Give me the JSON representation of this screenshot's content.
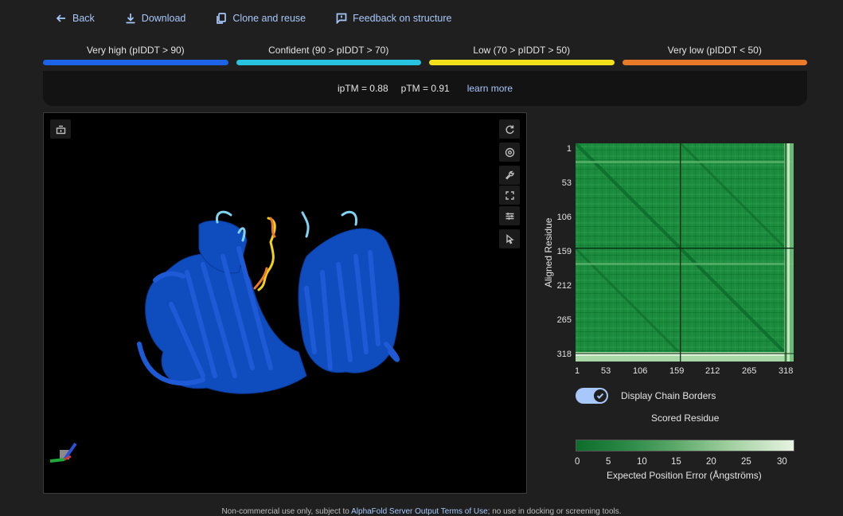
{
  "toolbar": {
    "back_label": "Back",
    "download_label": "Download",
    "clone_label": "Clone and reuse",
    "feedback_label": "Feedback on structure"
  },
  "plddt_legend": [
    {
      "label": "Very high (pIDDT > 90)",
      "color": "#1c63e8"
    },
    {
      "label": "Confident (90 > pIDDT > 70)",
      "color": "#27c3e0"
    },
    {
      "label": "Low (70 > pIDDT > 50)",
      "color": "#f2e01a"
    },
    {
      "label": "Very low (pIDDT < 50)",
      "color": "#ea7a2a"
    }
  ],
  "scores": {
    "iptm": "ipTM = 0.88",
    "ptm": "pTM = 0.91",
    "learn_more": "learn more"
  },
  "viewer": {
    "icons": [
      "expand-panel-icon",
      "rotate-icon",
      "focus-icon",
      "wrench-icon",
      "fullscreen-icon",
      "sliders-icon",
      "cursor-icon"
    ]
  },
  "pae": {
    "y_axis_label": "Aligned Residue",
    "x_axis_label": "Scored Residue",
    "ticks": [
      "1",
      "53",
      "106",
      "159",
      "212",
      "265",
      "318"
    ],
    "chain_border_residue": 159,
    "display_chain_borders_label": "Display Chain Borders",
    "display_chain_borders": true,
    "colorbar_ticks": [
      "0",
      "5",
      "10",
      "15",
      "20",
      "25",
      "30"
    ],
    "colorbar_title": "Expected Position Error (Ångströms)"
  },
  "footer": {
    "prefix": "Non-commercial use only, subject to ",
    "link": "AlphaFold Server Output Terms of Use",
    "suffix": "; no use in docking or screening tools."
  }
}
